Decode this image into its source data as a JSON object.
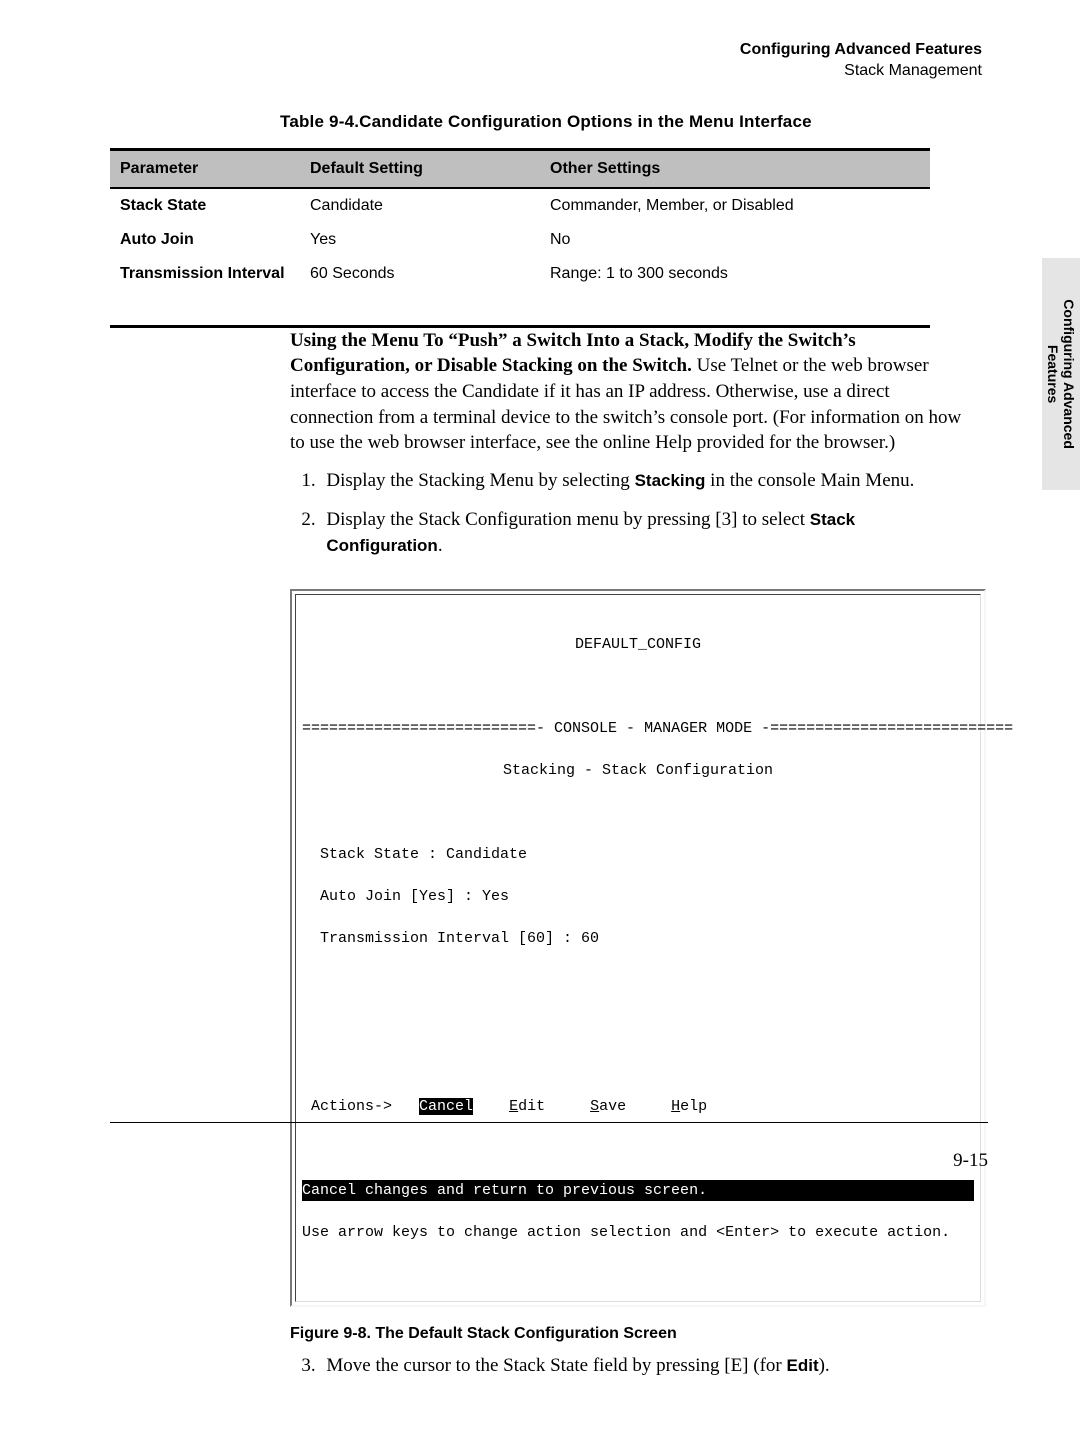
{
  "header": {
    "title": "Configuring Advanced Features",
    "subtitle": "Stack Management"
  },
  "sideTab": {
    "line1": "Configuring Advanced",
    "line2": "Features"
  },
  "tableCaption": "Table 9-4.Candidate Configuration Options in the Menu Interface",
  "table": {
    "head": {
      "c1": "Parameter",
      "c2": "Default Setting",
      "c3": "Other Settings"
    },
    "rows": [
      {
        "c1": "Stack State",
        "c2": "Candidate",
        "c3": "Commander, Member, or Disabled"
      },
      {
        "c1": "Auto Join",
        "c2": "Yes",
        "c3": "No"
      },
      {
        "c1": "Transmission Interval",
        "c2": "60 Seconds",
        "c3": "Range: 1 to 300 seconds"
      }
    ]
  },
  "paragraph": {
    "leadBold": "Using the Menu To “Push” a Switch Into a Stack, Modify the Switch’s Configuration, or Disable Stacking on the Switch.",
    "rest": "  Use Telnet or the web browser interface to access the Candidate if it has an IP address. Otherwise, use a direct connection from a terminal device to the switch’s console port. (For information on how to use the web browser interface, see the online Help provided for the browser.)"
  },
  "steps": {
    "s1a": "Display the Stacking Menu by selecting ",
    "s1b": "Stacking",
    "s1c": " in the console Main Menu.",
    "s2a": "Display the Stack Configuration menu by pressing [3] to select ",
    "s2b": "Stack Configuration",
    "s2c": ".",
    "s3a": "Move the cursor to the Stack State field by pressing [E] (for ",
    "s3b": "Edit",
    "s3c": ")."
  },
  "terminal": {
    "title": "DEFAULT_CONFIG",
    "ruleLabel": " CONSOLE - MANAGER MODE ",
    "subtitle": "Stacking - Stack Configuration",
    "l1": "  Stack State : Candidate",
    "l2": "  Auto Join [Yes] : Yes",
    "l3": "  Transmission Interval [60] : 60",
    "actionsLabel": " Actions->   ",
    "actCancel": "Cancel",
    "gap1": "    ",
    "actEditU": "E",
    "actEdit": "dit     ",
    "actSaveU": "S",
    "actSave": "ave     ",
    "actHelpU": "H",
    "actHelp": "elp",
    "statusLine": "Cancel changes and return to previous screen.                                 ",
    "hintLine": "Use arrow keys to change action selection and <Enter> to execute action."
  },
  "figureCaption": "Figure 9-8.  The Default Stack Configuration Screen",
  "pageNum": "9-15"
}
